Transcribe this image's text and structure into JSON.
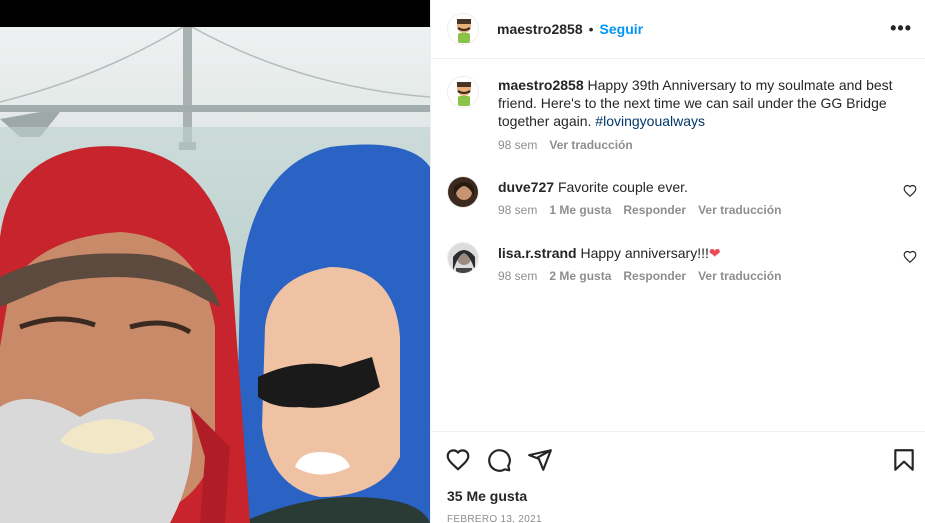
{
  "post": {
    "username": "maestro2858",
    "follow_label": "Seguir",
    "caption_user": "maestro2858",
    "caption_text": "Happy 39th Anniversary to my soulmate and best friend. Here's to the next time we can sail under the GG Bridge together again.",
    "hashtag": "#lovingyoualways",
    "caption_age": "98 sem",
    "caption_translate": "Ver traducción",
    "likes": "35 Me gusta",
    "date": "FEBRERO 13, 2021"
  },
  "comments": [
    {
      "user": "duve727",
      "text": "Favorite couple ever.",
      "age": "98 sem",
      "likes": "1 Me gusta",
      "reply": "Responder",
      "translate": "Ver traducción"
    },
    {
      "user": "lisa.r.strand",
      "text": "Happy anniversary!!!",
      "emoji": "❤",
      "age": "98 sem",
      "likes": "2 Me gusta",
      "reply": "Responder",
      "translate": "Ver traducción"
    }
  ],
  "colors": {
    "link": "#0095f6",
    "hashtag": "#00376b",
    "muted": "#8e8e8e",
    "heart": "#ed4956"
  },
  "icons": [
    "more-options-icon",
    "heart-icon",
    "comment-icon",
    "share-icon",
    "bookmark-icon"
  ]
}
